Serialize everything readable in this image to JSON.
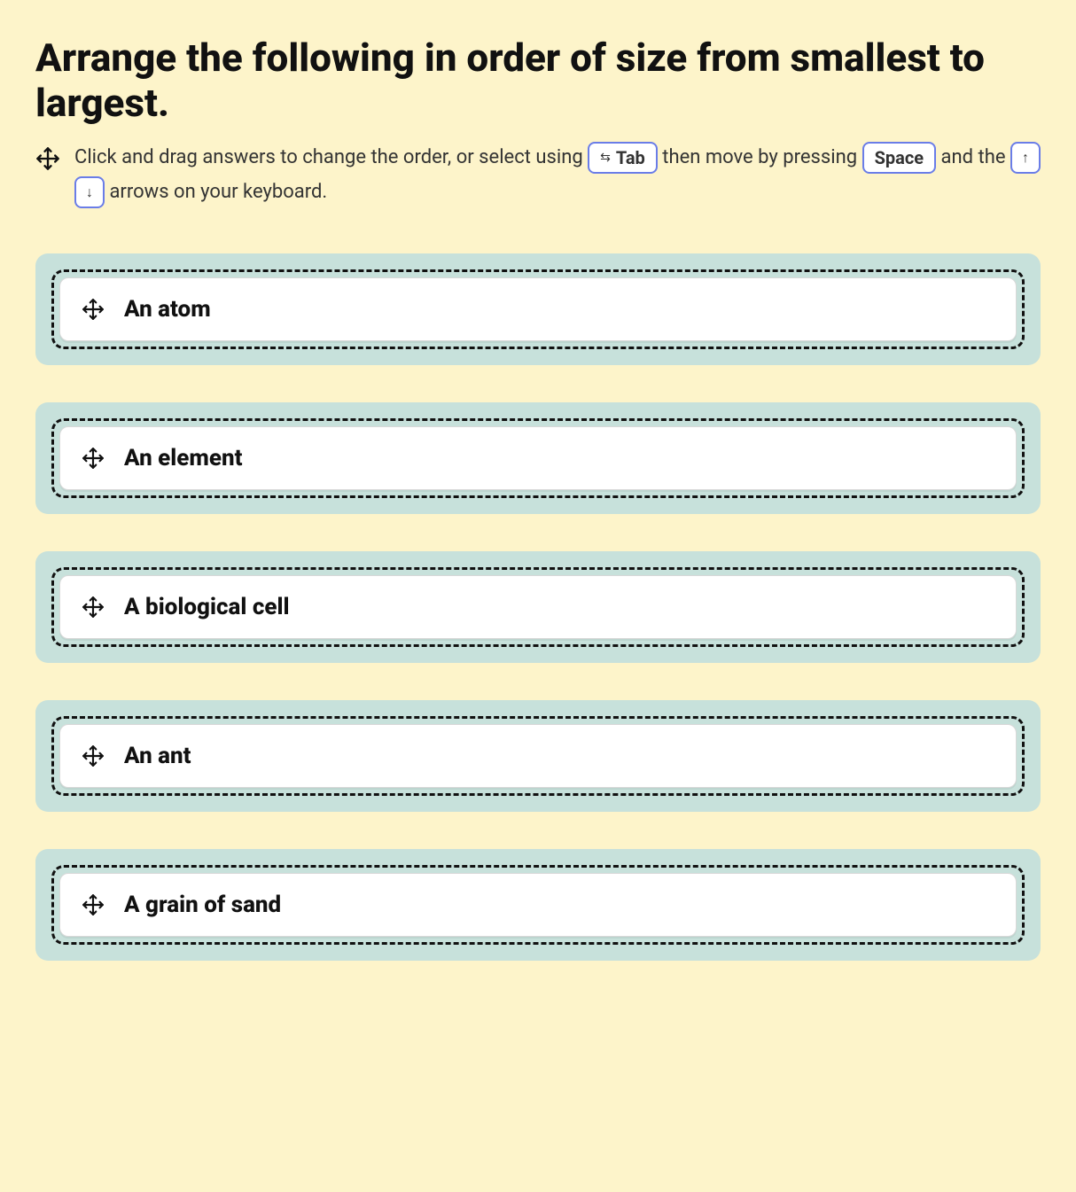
{
  "question": {
    "title": "Arrange the following in order of size from smallest to largest."
  },
  "instructions": {
    "text_before_tab": "Click and drag answers to change the order, or select using ",
    "tab_key": "Tab",
    "text_after_tab": " then move by pressing ",
    "space_key": "Space",
    "text_after_space": " and the ",
    "up_arrow": "↑",
    "down_arrow": "↓",
    "text_after_arrows": " arrows on your keyboard."
  },
  "answers": [
    {
      "label": "An atom"
    },
    {
      "label": "An element"
    },
    {
      "label": "A biological cell"
    },
    {
      "label": "An ant"
    },
    {
      "label": "A grain of sand"
    }
  ],
  "colors": {
    "page_bg": "#fdf4ca",
    "dropzone_bg": "#c7e1db",
    "kbd_border": "#6a7de8"
  }
}
